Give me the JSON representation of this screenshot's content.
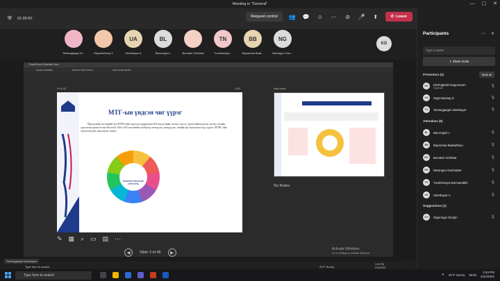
{
  "window": {
    "title": "Meeting in \"General\""
  },
  "toolbar": {
    "time": "01:06:50",
    "request_control": "Request control",
    "leave": "Leave"
  },
  "participants_row": [
    {
      "initials": "",
      "name": "Tsetsegjargal Ul...",
      "color": "#f0b6c8"
    },
    {
      "initials": "",
      "name": "Otgontsetseg S",
      "color": "#f3c7a9"
    },
    {
      "initials": "UA",
      "name": "Ulambayar A",
      "color": "#e6d5b0"
    },
    {
      "initials": "BL",
      "name": "Banzragch L",
      "color": "#dcdcdc"
    },
    {
      "initials": "",
      "name": "Bumdari Ochirbat",
      "color": "#f5d0c5"
    },
    {
      "initials": "TN",
      "name": "Tuvshinzaya...",
      "color": "#f2c8c8"
    },
    {
      "initials": "BB",
      "name": "Bayarmaa Baat...",
      "color": "#e6d5b0"
    },
    {
      "initials": "NG",
      "name": "Narangoo Gan...",
      "color": "#dcdcdc"
    }
  ],
  "extra_participant": {
    "initials": "KD"
  },
  "presentation": {
    "app_title": "PowerPoint Presenter View",
    "tools": [
      "SHOW TASKBAR",
      "DISPLAY SETTINGS ▾",
      "END SLIDE SHOW"
    ],
    "timer": "0:01:42",
    "counter": "1:53",
    "next_slide_label": "Next slide",
    "notes": "No Notes.",
    "slide_nav": "Slide 3 of 46",
    "slide": {
      "title": "МТГ-ын үндсэн чиг үүрэг",
      "body": "Мэдээллийн системийн бүх МУИС-ийн сургууль удирдлагын SIS мэдээллийн систем, эксэлэ, бүртгэлийн нэгдсэн систем, онлайн сургалтын цахим болон Microsoft Office 365 системийн хэлбэрээр хөгжүүлэх, нэвтрүүлэх, хэвийн үйл ажиллагаа бүгд хүргэх. МУИС-ийн сургалтын үйл ажиллагааг хангах",
      "center": "МОНГОЛ УЛСЫН ИХ СУРГУУЛЬ"
    }
  },
  "watermark": {
    "line1": "Activate Windows",
    "line2": "Go to Settings to activate Windows."
  },
  "inner_taskbar": {
    "label": "Tsetsegjargal Ulambayar",
    "search": "Type here to search",
    "weather": "20°F  Sunny",
    "time": "1:53 PM",
    "date": "2/24/2022"
  },
  "panel": {
    "title": "Participants",
    "search_placeholder": "Type a name",
    "share_invite": "Share invite",
    "presenters_label": "Presenters (3)",
    "mute_all": "Mute all",
    "presenters": [
      {
        "initials": "KD",
        "name": "Khishigbold Dolgorsuren",
        "role": "Organizer"
      },
      {
        "initials": "OS",
        "name": "Otgontsetseg S",
        "role": ""
      },
      {
        "initials": "TU",
        "name": "Tsetsegjargal Ulambayar",
        "role": ""
      }
    ],
    "attendees_label": "Attendees (6)",
    "attendees": [
      {
        "initials": "BL",
        "name": "Banzragch L"
      },
      {
        "initials": "BB",
        "name": "Bayarmaa Baatarkhuu"
      },
      {
        "initials": "BO",
        "name": "Bumdari Ochirbat"
      },
      {
        "initials": "NG",
        "name": "Narangoo Ganbaatar"
      },
      {
        "initials": "TN",
        "name": "Tuvshinzaya Narmandakh"
      },
      {
        "initials": "UA",
        "name": "Ulambayar A"
      }
    ],
    "suggestions_label": "Suggestions (1)",
    "suggestions": [
      {
        "initials": "OO",
        "name": "Otgontugs Osorjin"
      }
    ]
  },
  "taskbar": {
    "search_placeholder": "Type here to search",
    "weather": "20°F  Sunny",
    "lang": "MON",
    "time": "1:53 PM",
    "date": "2/24/2022"
  }
}
